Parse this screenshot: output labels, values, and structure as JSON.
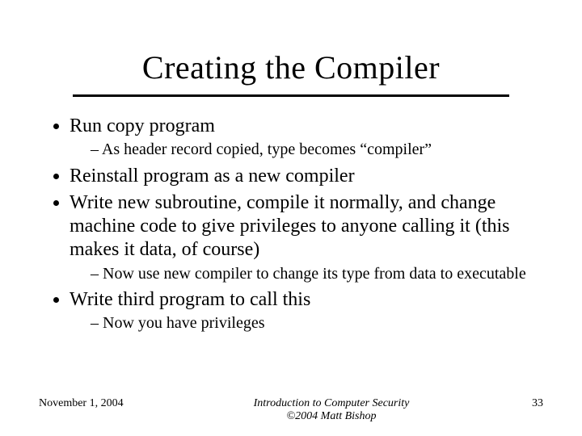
{
  "title": "Creating the Compiler",
  "b1": "Run copy program",
  "b1s1": "As header record copied, type becomes “compiler”",
  "b2": "Reinstall program as a new compiler",
  "b3": "Write new subroutine, compile it normally, and change machine code to give privileges to anyone calling it (this makes it data, of course)",
  "b3s1": "Now use new compiler to change its type from data to executable",
  "b4": "Write third program to call this",
  "b4s1": "Now you have privileges",
  "footer_date": "November 1, 2004",
  "footer_title": "Introduction to Computer Security",
  "footer_copy": "©2004 Matt Bishop",
  "footer_page": "33"
}
